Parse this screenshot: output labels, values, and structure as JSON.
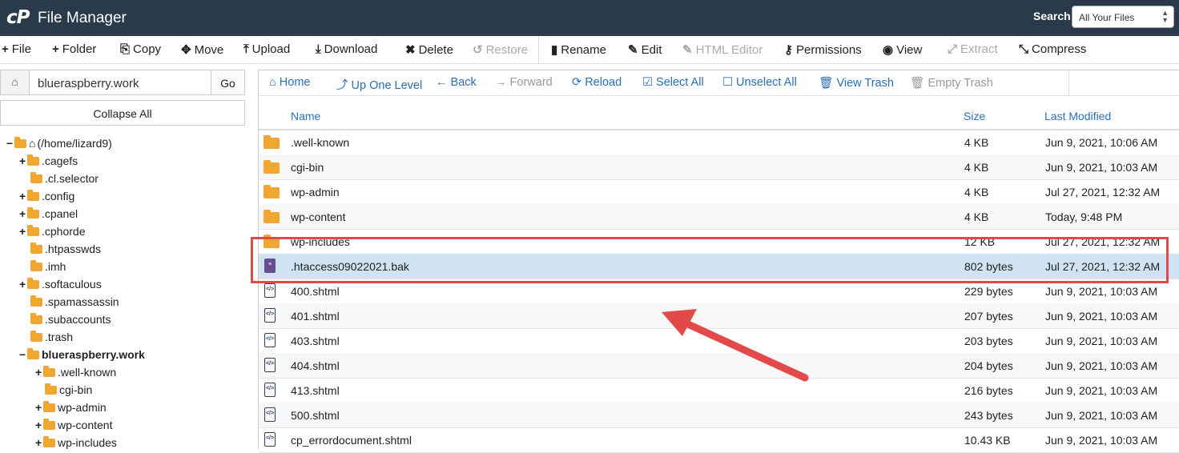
{
  "header": {
    "logo_text": "cP",
    "title": "File Manager",
    "search_label": "Search",
    "search_scope": "All Your Files"
  },
  "toolbar": {
    "file": "File",
    "folder": "Folder",
    "copy": "Copy",
    "move": "Move",
    "upload": "Upload",
    "download": "Download",
    "delete": "Delete",
    "restore": "Restore",
    "rename": "Rename",
    "edit": "Edit",
    "html_editor": "HTML Editor",
    "permissions": "Permissions",
    "view": "View",
    "extract": "Extract",
    "compress": "Compress"
  },
  "left": {
    "path_value": "blueraspberry.work",
    "go_label": "Go",
    "collapse_label": "Collapse All",
    "tree": [
      {
        "toggle": "−",
        "label": "(/home/lizard9)"
      },
      {
        "toggle": "+",
        "label": ".cagefs"
      },
      {
        "toggle": "",
        "label": ".cl.selector"
      },
      {
        "toggle": "+",
        "label": ".config"
      },
      {
        "toggle": "+",
        "label": ".cpanel"
      },
      {
        "toggle": "+",
        "label": ".cphorde"
      },
      {
        "toggle": "",
        "label": ".htpasswds"
      },
      {
        "toggle": "",
        "label": ".imh"
      },
      {
        "toggle": "+",
        "label": ".softaculous"
      },
      {
        "toggle": "",
        "label": ".spamassassin"
      },
      {
        "toggle": "",
        "label": ".subaccounts"
      },
      {
        "toggle": "",
        "label": ".trash"
      },
      {
        "toggle": "−",
        "label": "blueraspberry.work"
      },
      {
        "toggle": "+",
        "label": ".well-known"
      },
      {
        "toggle": "",
        "label": "cgi-bin"
      },
      {
        "toggle": "+",
        "label": "wp-admin"
      },
      {
        "toggle": "+",
        "label": "wp-content"
      },
      {
        "toggle": "+",
        "label": "wp-includes"
      }
    ]
  },
  "nav": {
    "home": "Home",
    "up": "Up One Level",
    "back": "Back",
    "forward": "Forward",
    "reload": "Reload",
    "select_all": "Select All",
    "unselect_all": "Unselect All",
    "view_trash": "View Trash",
    "empty_trash": "Empty Trash"
  },
  "table": {
    "headers": {
      "name": "Name",
      "size": "Size",
      "modified": "Last Modified"
    },
    "rows": [
      {
        "name": ".well-known",
        "size": "4 KB",
        "modified": "Jun 9, 2021, 10:06 AM",
        "type": "folder"
      },
      {
        "name": "cgi-bin",
        "size": "4 KB",
        "modified": "Jun 9, 2021, 10:03 AM",
        "type": "folder"
      },
      {
        "name": "wp-admin",
        "size": "4 KB",
        "modified": "Jul 27, 2021, 12:32 AM",
        "type": "folder"
      },
      {
        "name": "wp-content",
        "size": "4 KB",
        "modified": "Today, 9:48 PM",
        "type": "folder"
      },
      {
        "name": "wp-includes",
        "size": "12 KB",
        "modified": "Jul 27, 2021, 12:32 AM",
        "type": "folder"
      },
      {
        "name": ".htaccess09022021.bak",
        "size": "802 bytes",
        "modified": "Jul 27, 2021, 12:32 AM",
        "type": "text"
      },
      {
        "name": "400.shtml",
        "size": "229 bytes",
        "modified": "Jun 9, 2021, 10:03 AM",
        "type": "code"
      },
      {
        "name": "401.shtml",
        "size": "207 bytes",
        "modified": "Jun 9, 2021, 10:03 AM",
        "type": "code"
      },
      {
        "name": "403.shtml",
        "size": "203 bytes",
        "modified": "Jun 9, 2021, 10:03 AM",
        "type": "code"
      },
      {
        "name": "404.shtml",
        "size": "204 bytes",
        "modified": "Jun 9, 2021, 10:03 AM",
        "type": "code"
      },
      {
        "name": "413.shtml",
        "size": "216 bytes",
        "modified": "Jun 9, 2021, 10:03 AM",
        "type": "code"
      },
      {
        "name": "500.shtml",
        "size": "243 bytes",
        "modified": "Jun 9, 2021, 10:03 AM",
        "type": "code"
      },
      {
        "name": "cp_errordocument.shtml",
        "size": "10.43 KB",
        "modified": "Jun 9, 2021, 10:03 AM",
        "type": "code"
      }
    ]
  },
  "colors": {
    "header_bg": "#293a4a",
    "link_blue": "#2a6fb8",
    "folder_orange": "#f0a732",
    "selected_row": "#cfe3f3",
    "highlight_red": "#e24a4a"
  }
}
